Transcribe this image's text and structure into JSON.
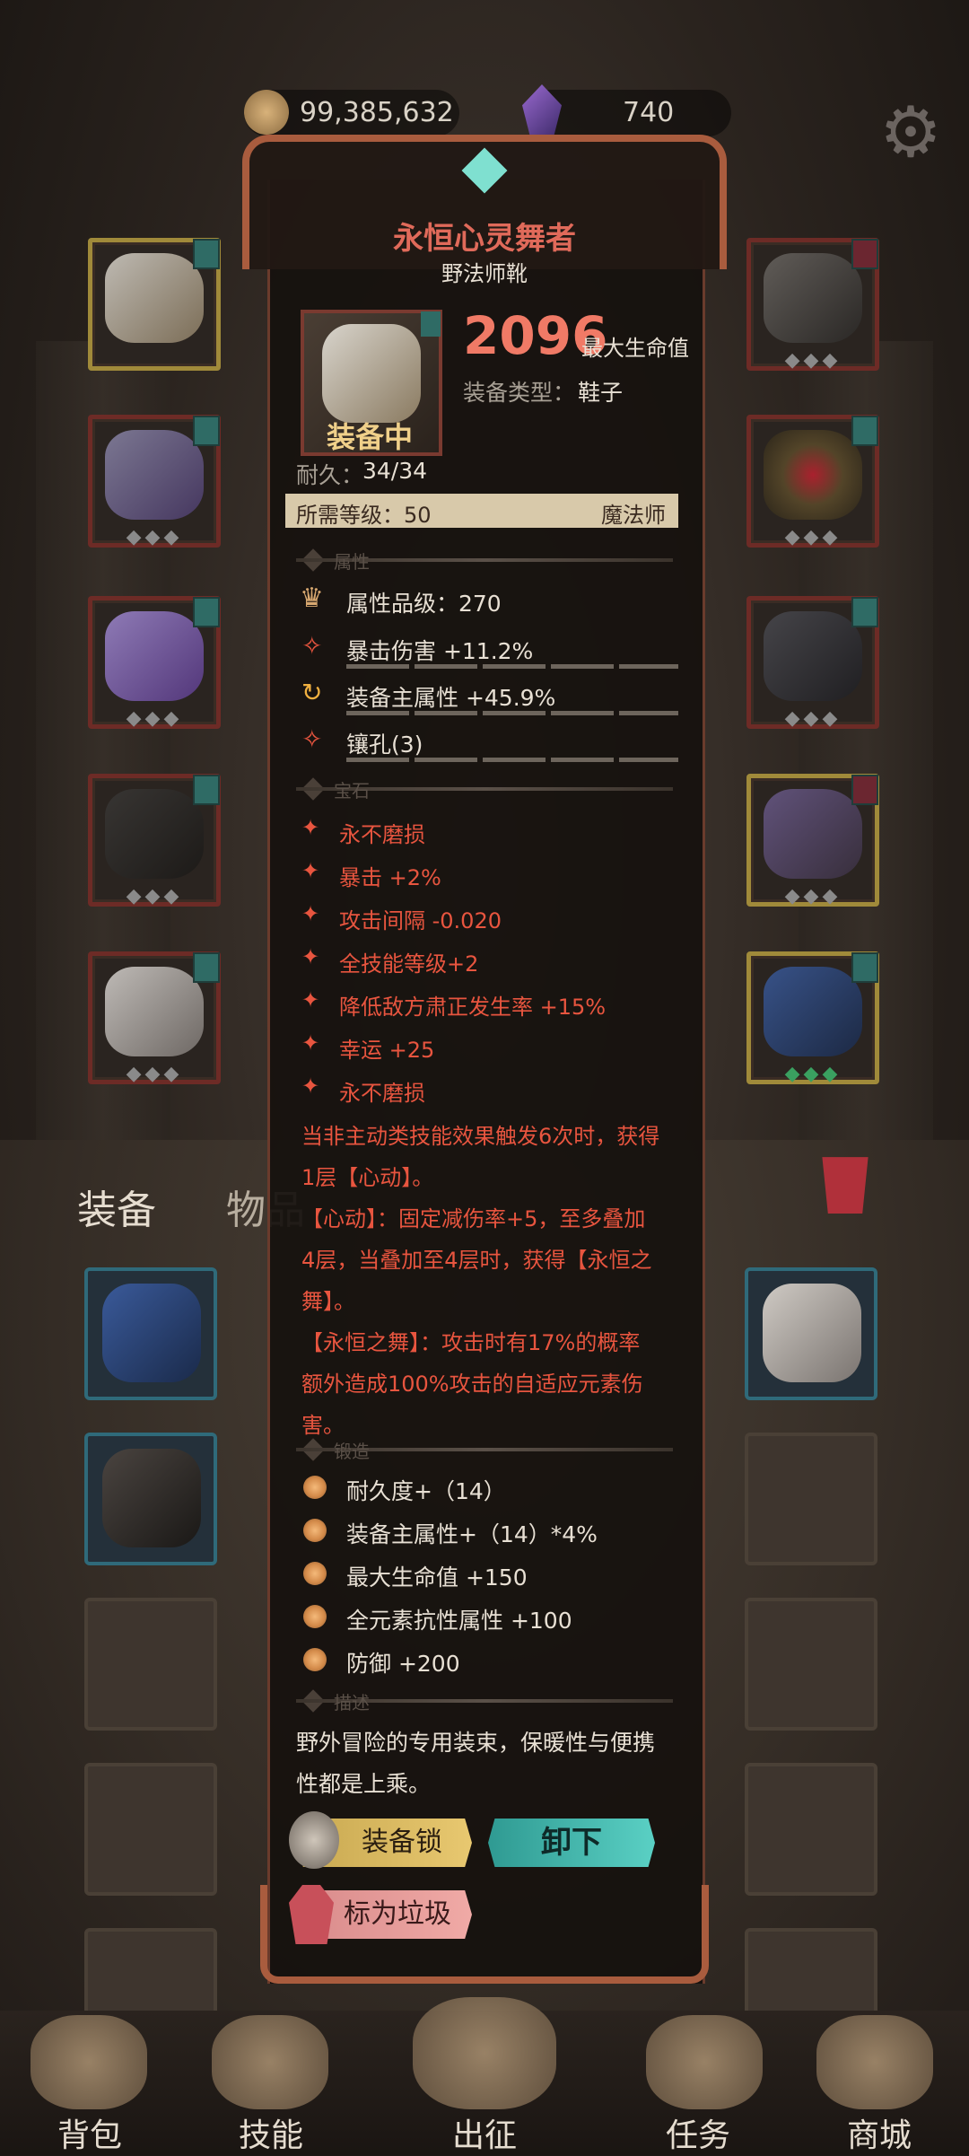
{
  "currency": {
    "gold": "99,385,632",
    "gems": "740"
  },
  "tabs": {
    "equip": "装备",
    "items": "物品"
  },
  "item": {
    "name": "永恒心灵舞者",
    "subtitle": "野法师靴",
    "main_value": "2096",
    "main_stat": "最大生命值",
    "type_label": "装备类型：",
    "type_value": "鞋子",
    "equipped": "装备中",
    "durability_label": "耐久：",
    "durability_value": "34/34",
    "level_label": "所需等级：50",
    "class": "魔法师"
  },
  "sections": {
    "attributes": "属性",
    "gems": "宝石",
    "forge": "锻造",
    "description": "描述"
  },
  "attributes": [
    "属性品级：270",
    "暴击伤害 +11.2%",
    "装备主属性 +45.9%",
    "镶孔(3)"
  ],
  "gem_lines": [
    "永不磨损",
    "暴击 +2%",
    "攻击间隔 -0.020",
    "全技能等级+2",
    "降低敌方肃正发生率 +15%",
    "幸运 +25",
    "永不磨损"
  ],
  "set_effect": [
    "当非主动类技能效果触发6次时，获得",
    "1层【心动】。",
    "【心动】：固定减伤率+5，至多叠加",
    "4层，当叠加至4层时，获得【永恒之",
    "舞】。",
    "【永恒之舞】：攻击时有17%的概率",
    "额外造成100%攻击的自适应元素伤",
    "害。"
  ],
  "forge_lines": [
    "耐久度+（14）",
    "装备主属性+（14）*4%",
    "最大生命值 +150",
    "全元素抗性属性 +100",
    "防御 +200"
  ],
  "description": [
    "野外冒险的专用装束，保暖性与便携",
    "性都是上乘。"
  ],
  "buttons": {
    "lock": "装备锁",
    "unequip": "卸下",
    "junk": "标为垃圾"
  },
  "nav": [
    "背包",
    "技能",
    "出征",
    "任务",
    "商城"
  ],
  "colors": {
    "red_text": "#e8553f",
    "title_red": "#e06a5a",
    "gold_text": "#e8c98a"
  }
}
